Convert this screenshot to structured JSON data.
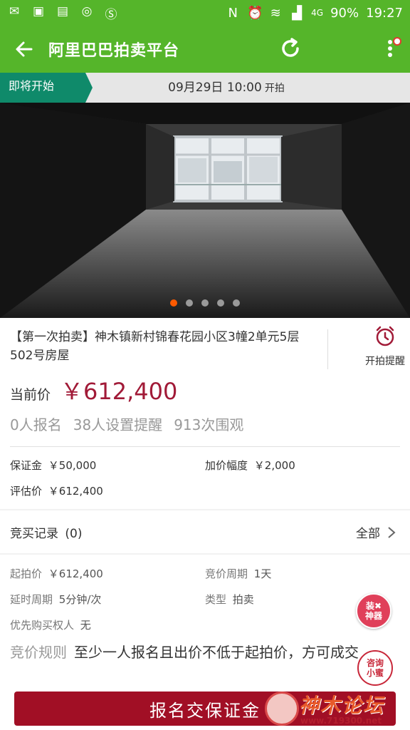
{
  "status_bar": {
    "battery": "90%",
    "time": "19:27",
    "network": "4G",
    "icons": [
      "mail-icon",
      "image-icon",
      "sms-icon",
      "sync-icon",
      "s-app-icon",
      "n-icon",
      "alarm-icon",
      "wifi-icon",
      "signal-icon"
    ]
  },
  "app_bar": {
    "title": "阿里巴巴拍卖平台"
  },
  "start_bar": {
    "tag": "即将开始",
    "datetime": "09月29日 10:00",
    "suffix": "开拍"
  },
  "carousel": {
    "total": 5,
    "active": 1
  },
  "lot": {
    "title": "【第一次拍卖】神木镇新村锦春花园小区3幢2单元5层502号房屋",
    "remind_label": "开拍提醒",
    "price_label": "当前价",
    "price": "￥612,400",
    "stats": [
      "0人报名",
      "38人设置提醒",
      "913次围观"
    ],
    "deposit_label": "保证金",
    "deposit": "￥50,000",
    "increment_label": "加价幅度",
    "increment": "￥2,000",
    "appraisal_label": "评估价",
    "appraisal": "￥612,400"
  },
  "bids": {
    "label": "竞买记录",
    "count": "(0)",
    "all_label": "全部"
  },
  "info": {
    "start_price_label": "起拍价",
    "start_price": "￥612,400",
    "period_label": "竞价周期",
    "period": "1天",
    "delay_label": "延时周期",
    "delay": "5分钟/次",
    "type_label": "类型",
    "type": "拍卖",
    "priority_label": "优先购买权人",
    "priority": "无",
    "rule_label": "竞价规则",
    "rule": "至少一人报名且出价不低于起拍价，方可成交"
  },
  "floating": {
    "tools_line1": "装✖",
    "tools_line2": "神器",
    "consult_line1": "咨询",
    "consult_line2": "小蜜"
  },
  "footer": {
    "submit": "报名交保证金",
    "watermark_title": "神木论坛",
    "watermark_url": "www.719300.net"
  },
  "colors": {
    "brand_green": "#55b52a",
    "tag_teal": "#0f8a6a",
    "price_red": "#a11a37",
    "button_red": "#a10f25"
  }
}
